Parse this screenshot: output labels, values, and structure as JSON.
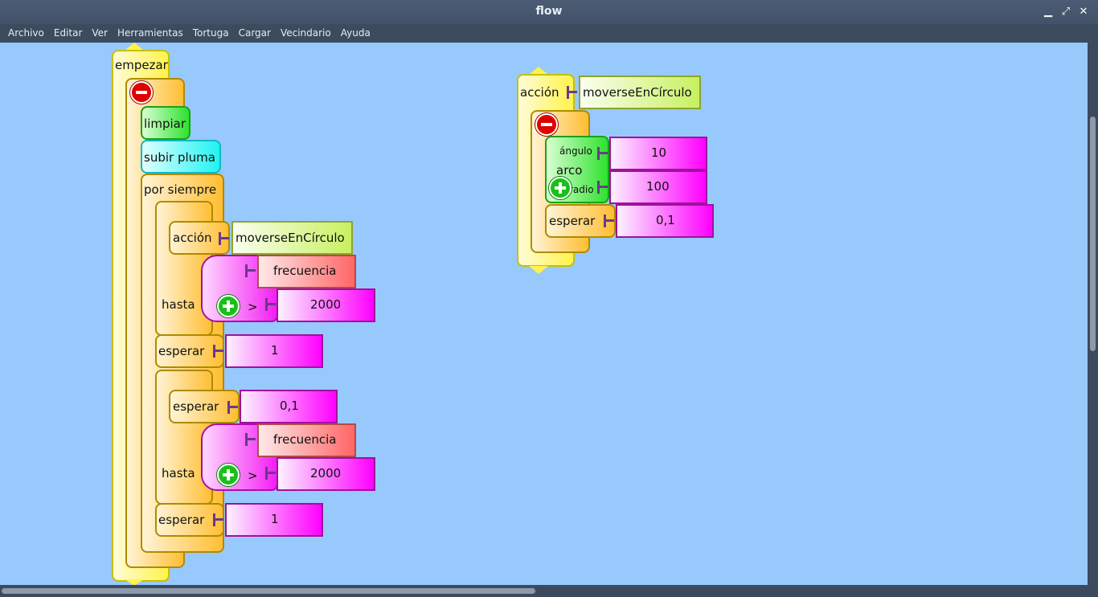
{
  "window": {
    "title": "flow"
  },
  "menu": [
    "Archivo",
    "Editar",
    "Ver",
    "Herramientas",
    "Tortuga",
    "Cargar",
    "Vecindario",
    "Ayuda"
  ],
  "blocks": {
    "start": "empezar",
    "clear": "limpiar",
    "pen_up": "subir pluma",
    "forever": "por siempre",
    "action_call_1": {
      "label": "acción",
      "name": "moverseEnCírculo"
    },
    "until_1": {
      "label": "hasta",
      "left": "frecuencia",
      "op": ">",
      "right": "2000"
    },
    "wait_1": {
      "label": "esperar",
      "value": "1"
    },
    "wait_2": {
      "label": "esperar",
      "value": "0,1"
    },
    "until_2": {
      "label": "hasta",
      "left": "frecuencia",
      "op": ">",
      "right": "2000"
    },
    "wait_3": {
      "label": "esperar",
      "value": "1"
    }
  },
  "action_def": {
    "label": "acción",
    "name": "moverseEnCírculo",
    "arc": {
      "label": "arco",
      "angle_label": "ángulo",
      "angle": "10",
      "radius_label": "radio",
      "radius": "100"
    },
    "wait": {
      "label": "esperar",
      "value": "0,1"
    }
  }
}
